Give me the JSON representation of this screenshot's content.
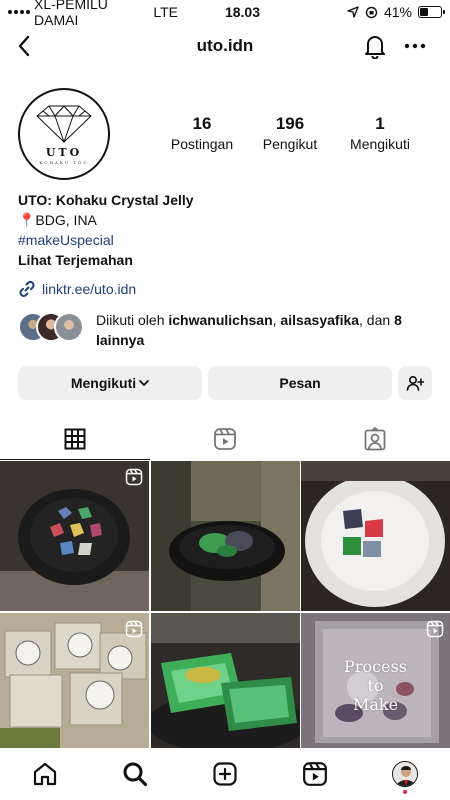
{
  "status_bar": {
    "carrier": "XL-PEMILU DAMAI",
    "network": "LTE",
    "time": "18.03",
    "battery": "41%",
    "battery_level": 0.41
  },
  "header": {
    "username": "uto.idn"
  },
  "avatar": {
    "brand": "UTO",
    "subtitle": "KOHAKU TOU"
  },
  "stats": [
    {
      "value": "16",
      "label": "Postingan"
    },
    {
      "value": "196",
      "label": "Pengikut"
    },
    {
      "value": "1",
      "label": "Mengikuti"
    }
  ],
  "bio": {
    "name": "UTO: Kohaku Crystal Jelly",
    "location": "📍BDG, INA",
    "hashtag": "#makeUspecial",
    "translate": "Lihat Terjemahan",
    "link": "linktr.ee/uto.idn"
  },
  "followed_by": {
    "prefix": "Diikuti oleh",
    "user1": "ichwanulichsan",
    "user2": "ailsasyafika",
    "connector": ", dan",
    "more": "8 lainnya"
  },
  "actions": {
    "following_label": "Mengikuti",
    "message_label": "Pesan"
  },
  "grid": {
    "overlay_text": "Process to Make"
  },
  "icons": {
    "back": "chevron-left-icon",
    "bell": "bell-icon",
    "more": "more-horizontal-icon",
    "link": "link-icon",
    "add_person": "add-person-icon",
    "grid": "grid-icon",
    "reels": "reels-icon",
    "tagged": "tagged-icon",
    "home": "home-icon",
    "search": "search-icon",
    "create": "create-icon",
    "reel_nav": "reels-nav-icon"
  },
  "colors": {
    "link_blue": "#1f3f7a",
    "button_gray": "#efefef",
    "notification_dot": "#e0245e"
  }
}
